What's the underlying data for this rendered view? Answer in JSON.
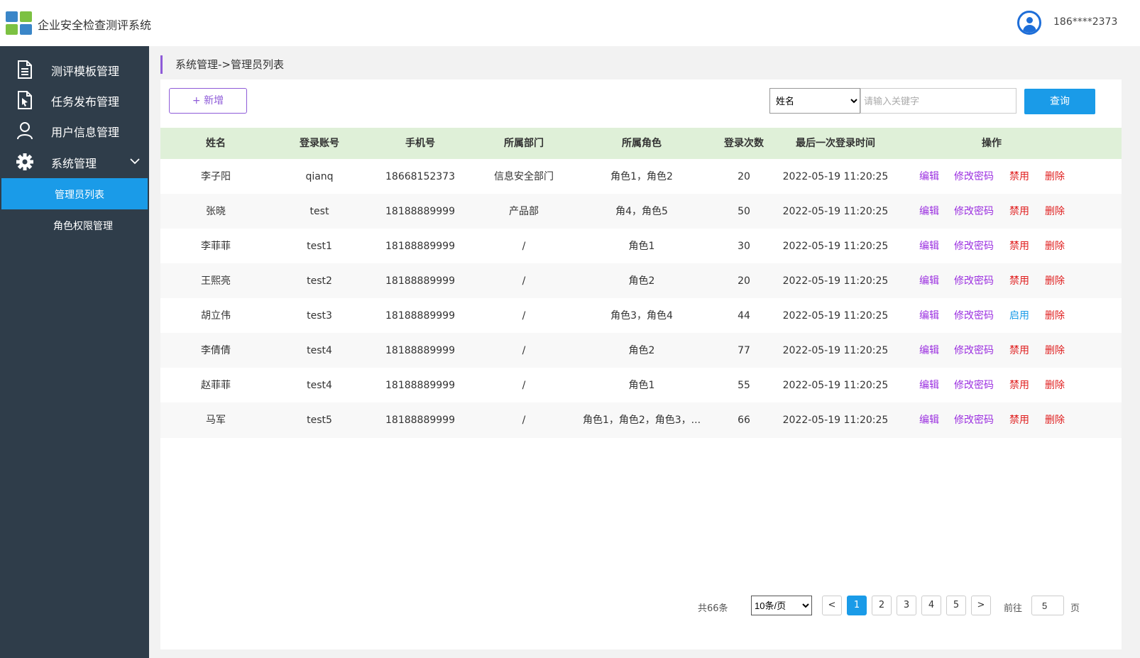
{
  "header": {
    "app_title": "企业安全检查测评系统",
    "user": "186****2373",
    "colors": {
      "logo_blue": "#3a86c8",
      "logo_green": "#7cc142",
      "avatar": "#1e6ed8"
    }
  },
  "sidebar": {
    "items": [
      {
        "label": "测评模板管理",
        "icon": "document-icon"
      },
      {
        "label": "任务发布管理",
        "icon": "task-doc-icon"
      },
      {
        "label": "用户信息管理",
        "icon": "user-icon"
      },
      {
        "label": "系统管理",
        "icon": "gear-icon",
        "expanded": true
      }
    ],
    "sub_items": [
      {
        "label": "管理员列表",
        "active": true
      },
      {
        "label": "角色权限管理",
        "active": false
      }
    ],
    "colors": {
      "background": "#2f3d4a",
      "active": "#1a9be8"
    }
  },
  "breadcrumb": "系统管理->管理员列表",
  "toolbar": {
    "add_label": "+ 新增",
    "search_field": "姓名",
    "search_placeholder": "请输入关键字",
    "search_button": "查询"
  },
  "table": {
    "columns": [
      "姓名",
      "登录账号",
      "手机号",
      "所属部门",
      "所属角色",
      "登录次数",
      "最后一次登录时间",
      "操作"
    ],
    "rows": [
      {
        "name": "李子阳",
        "account": "qianq",
        "phone": "18668152373",
        "dept": "信息安全部门",
        "roles": "角色1，角色2",
        "logins": "20",
        "last": "2022-05-19 11:20:25",
        "toggle": "禁用",
        "toggle_color": "red"
      },
      {
        "name": "张晓",
        "account": "test",
        "phone": "18188889999",
        "dept": "产品部",
        "roles": "角4，角色5",
        "logins": "50",
        "last": "2022-05-19 11:20:25",
        "toggle": "禁用",
        "toggle_color": "red"
      },
      {
        "name": "李菲菲",
        "account": "test1",
        "phone": "18188889999",
        "dept": "/",
        "roles": "角色1",
        "logins": "30",
        "last": "2022-05-19 11:20:25",
        "toggle": "禁用",
        "toggle_color": "red"
      },
      {
        "name": "王熙亮",
        "account": "test2",
        "phone": "18188889999",
        "dept": "/",
        "roles": "角色2",
        "logins": "20",
        "last": "2022-05-19 11:20:25",
        "toggle": "禁用",
        "toggle_color": "red"
      },
      {
        "name": "胡立伟",
        "account": "test3",
        "phone": "18188889999",
        "dept": "/",
        "roles": "角色3，角色4",
        "logins": "44",
        "last": "2022-05-19 11:20:25",
        "toggle": "启用",
        "toggle_color": "blue"
      },
      {
        "name": "李倩倩",
        "account": "test4",
        "phone": "18188889999",
        "dept": "/",
        "roles": "角色2",
        "logins": "77",
        "last": "2022-05-19 11:20:25",
        "toggle": "禁用",
        "toggle_color": "red"
      },
      {
        "name": "赵菲菲",
        "account": "test4",
        "phone": "18188889999",
        "dept": "/",
        "roles": "角色1",
        "logins": "55",
        "last": "2022-05-19 11:20:25",
        "toggle": "禁用",
        "toggle_color": "red"
      },
      {
        "name": "马军",
        "account": "test5",
        "phone": "18188889999",
        "dept": "/",
        "roles": "角色1，角色2，角色3，...",
        "logins": "66",
        "last": "2022-05-19 11:20:25",
        "toggle": "禁用",
        "toggle_color": "red"
      }
    ],
    "actions": {
      "edit": "编辑",
      "password": "修改密码",
      "delete": "删除"
    },
    "colors": {
      "header_bg": "#dff0d8",
      "purple": "#9b30e0",
      "red": "#e02020",
      "blue": "#1a9be8"
    }
  },
  "pagination": {
    "total": "共66条",
    "page_size": "10条/页",
    "prev": "<",
    "pages": [
      "1",
      "2",
      "3",
      "4",
      "5"
    ],
    "current": "1",
    "next": ">",
    "goto_label": "前往",
    "goto_value": "5",
    "page_label": "页"
  }
}
